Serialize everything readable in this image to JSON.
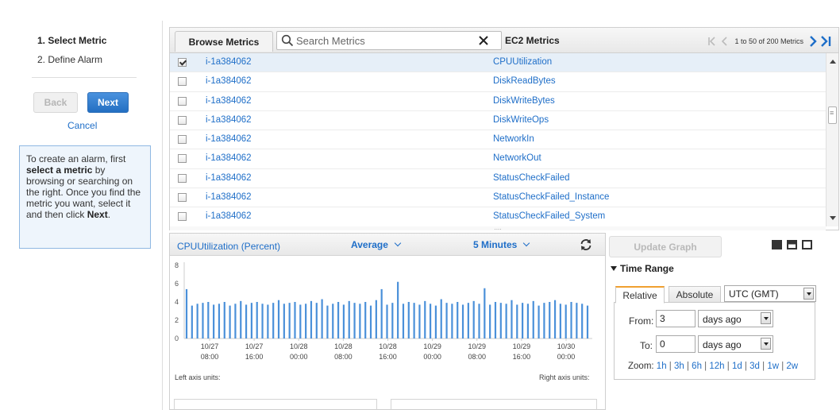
{
  "wizard": {
    "steps": [
      "1. Select Metric",
      "2. Define Alarm"
    ],
    "back_label": "Back",
    "next_label": "Next",
    "cancel_label": "Cancel",
    "help": {
      "p1": "To create an alarm, first ",
      "p2": "select a metric",
      "p3": " by browsing or searching on the right. Once you find the metric you want, select it and then click ",
      "p4": "Next",
      "p5": "."
    }
  },
  "browser": {
    "tab_label": "Browse Metrics",
    "search_placeholder": "Search Metrics",
    "namespace_label": "EC2 Metrics",
    "pager_text": "1 to 50 of 200 Metrics",
    "rows": [
      {
        "instance": "i-1a384062",
        "metric": "CPUUtilization",
        "checked": true
      },
      {
        "instance": "i-1a384062",
        "metric": "DiskReadBytes",
        "checked": false
      },
      {
        "instance": "i-1a384062",
        "metric": "DiskWriteBytes",
        "checked": false
      },
      {
        "instance": "i-1a384062",
        "metric": "DiskWriteOps",
        "checked": false
      },
      {
        "instance": "i-1a384062",
        "metric": "NetworkIn",
        "checked": false
      },
      {
        "instance": "i-1a384062",
        "metric": "NetworkOut",
        "checked": false
      },
      {
        "instance": "i-1a384062",
        "metric": "StatusCheckFailed",
        "checked": false
      },
      {
        "instance": "i-1a384062",
        "metric": "StatusCheckFailed_Instance",
        "checked": false
      },
      {
        "instance": "i-1a384062",
        "metric": "StatusCheckFailed_System",
        "checked": false
      }
    ]
  },
  "graph": {
    "title": "CPUUtilization (Percent)",
    "statistic": "Average",
    "period": "5 Minutes",
    "left_units_label": "Left axis units:",
    "right_units_label": "Right axis units:"
  },
  "chart_data": {
    "type": "bar",
    "title": "CPUUtilization (Percent)",
    "ylim": [
      0,
      8
    ],
    "yticks": [
      0,
      2,
      4,
      6,
      8
    ],
    "x_tick_labels": [
      {
        "date": "10/27",
        "time": "08:00"
      },
      {
        "date": "10/27",
        "time": "16:00"
      },
      {
        "date": "10/28",
        "time": "00:00"
      },
      {
        "date": "10/28",
        "time": "08:00"
      },
      {
        "date": "10/28",
        "time": "16:00"
      },
      {
        "date": "10/29",
        "time": "00:00"
      },
      {
        "date": "10/29",
        "time": "08:00"
      },
      {
        "date": "10/29",
        "time": "16:00"
      },
      {
        "date": "10/30",
        "time": "00:00"
      }
    ],
    "values": [
      5.4,
      3.6,
      3.8,
      3.9,
      4.0,
      3.7,
      3.8,
      4.0,
      3.6,
      3.8,
      4.1,
      3.7,
      3.9,
      4.0,
      3.8,
      3.7,
      3.9,
      4.2,
      3.8,
      3.9,
      4.0,
      3.7,
      3.8,
      4.1,
      3.9,
      4.3,
      3.6,
      3.8,
      4.0,
      3.7,
      4.1,
      3.9,
      3.8,
      4.0,
      3.6,
      4.2,
      5.4,
      3.7,
      3.9,
      6.2,
      3.8,
      4.0,
      3.9,
      3.7,
      4.1,
      3.8,
      3.6,
      4.3,
      3.9,
      3.8,
      4.0,
      3.7,
      3.9,
      4.1,
      3.8,
      5.5,
      3.7,
      4.0,
      3.9,
      3.8,
      4.2,
      3.7,
      3.9,
      3.8,
      4.1,
      3.6,
      3.9,
      4.0,
      4.2,
      3.8,
      3.7,
      4.0,
      3.9,
      3.8,
      3.6
    ]
  },
  "controls": {
    "update_label": "Update Graph",
    "time_range_label": "Time Range",
    "tab_relative": "Relative",
    "tab_absolute": "Absolute",
    "timezone": "UTC (GMT)",
    "from_label": "From:",
    "from_value": "3",
    "from_unit": "days ago",
    "to_label": "To:",
    "to_value": "0",
    "to_unit": "days ago",
    "zoom_label": "Zoom:",
    "zoom_options": [
      "1h",
      "3h",
      "6h",
      "12h",
      "1d",
      "3d",
      "1w",
      "2w"
    ]
  },
  "colors": {
    "link": "#1e6ec8",
    "bar": "#4a90d9",
    "accent_tab": "#f0a030"
  }
}
